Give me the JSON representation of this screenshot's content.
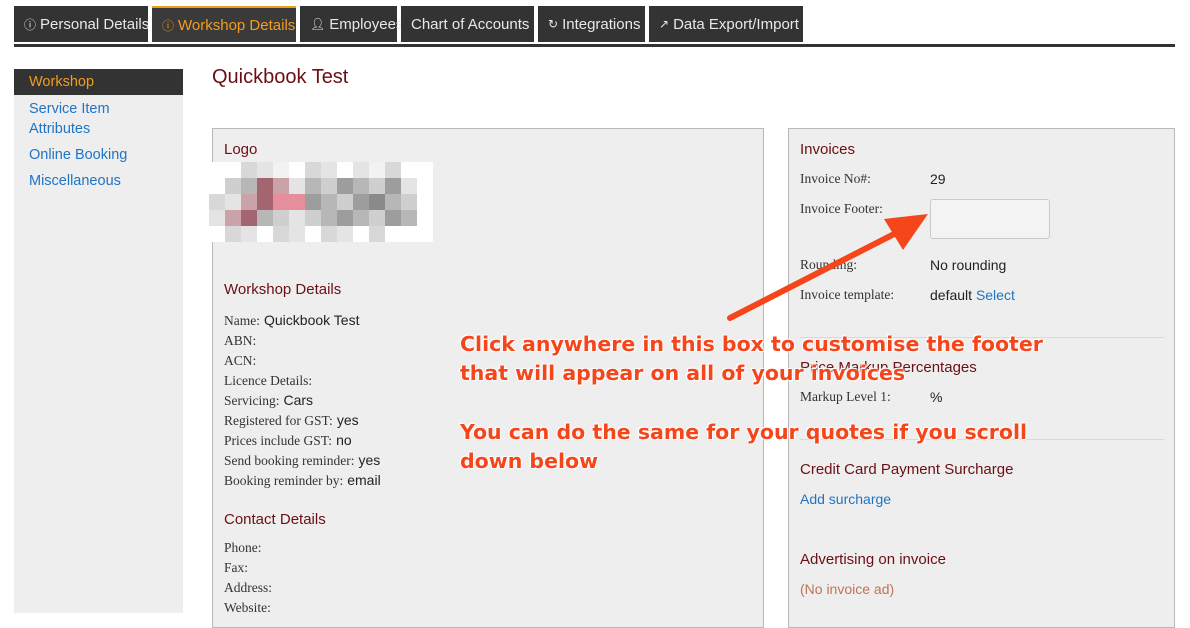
{
  "tabs": [
    {
      "label": "Personal Details",
      "icon": "info-icon"
    },
    {
      "label": "Workshop Details",
      "icon": "info-icon"
    },
    {
      "label": "Employees",
      "icon": "user-icon"
    },
    {
      "label": "Chart of Accounts",
      "icon": ""
    },
    {
      "label": "Integrations",
      "icon": "refresh-icon"
    },
    {
      "label": "Data Export/Import",
      "icon": "external-link-icon"
    }
  ],
  "sidebar": {
    "items": [
      {
        "label": "Workshop"
      },
      {
        "label": "Service Item Attributes"
      },
      {
        "label": "Online Booking"
      },
      {
        "label": "Miscellaneous"
      }
    ]
  },
  "page_title": "Quickbook Test",
  "left_panel": {
    "logo_heading": "Logo",
    "workshop_heading": "Workshop Details",
    "fields": [
      {
        "label": "Name:",
        "value": "Quickbook Test"
      },
      {
        "label": "ABN:",
        "value": ""
      },
      {
        "label": "ACN:",
        "value": ""
      },
      {
        "label": "Licence Details:",
        "value": ""
      },
      {
        "label": "Servicing:",
        "value": "Cars"
      },
      {
        "label": "Registered for GST:",
        "value": "yes"
      },
      {
        "label": "Prices include GST:",
        "value": "no"
      },
      {
        "label": "Send booking reminder:",
        "value": "yes"
      },
      {
        "label": "Booking reminder by:",
        "value": "email"
      }
    ],
    "contact_heading": "Contact Details",
    "contact_fields": [
      {
        "label": "Phone:"
      },
      {
        "label": "Fax:"
      },
      {
        "label": "Address:"
      },
      {
        "label": "Website:"
      }
    ]
  },
  "right_panel": {
    "invoices_heading": "Invoices",
    "invoice_no_label": "Invoice No#:",
    "invoice_no_value": "29",
    "invoice_footer_label": "Invoice Footer:",
    "rounding_label": "Rounding:",
    "rounding_value": "No rounding",
    "template_label": "Invoice template:",
    "template_value": "default",
    "template_link": "Select",
    "markup_heading": "Price Markup Percentages",
    "markup_label": "Markup Level 1:",
    "markup_value": "%",
    "surcharge_heading": "Credit Card Payment Surcharge",
    "surcharge_link": "Add surcharge",
    "advertising_heading": "Advertising on invoice",
    "advertising_link": "(No invoice ad)"
  },
  "annotation": {
    "line1": "Click anywhere in this box to customise the footer",
    "line2": "that will appear on all of your invoices",
    "line3": "You can do the same for your quotes if you scroll",
    "line4": "down below"
  },
  "colors": {
    "accent": "#f39c1f",
    "heading": "#6b0f14",
    "link": "#1f74c4",
    "annotation": "#f5451a",
    "tab_bg": "#333333"
  }
}
